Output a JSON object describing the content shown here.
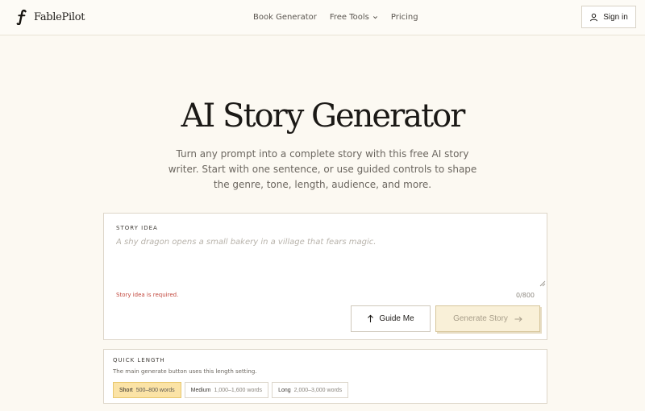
{
  "brand": {
    "name": "FablePilot",
    "logo_icon": "f-letter-logo-icon"
  },
  "nav": {
    "items": [
      {
        "label": "Book Generator"
      },
      {
        "label": "Free Tools",
        "icon": "chevron-down-icon"
      },
      {
        "label": "Pricing"
      }
    ]
  },
  "signin": {
    "label": "Sign in",
    "icon": "user-icon"
  },
  "hero": {
    "title": "AI Story Generator",
    "subtitle": "Turn any prompt into a complete story with this free AI story writer. Start with one sentence, or use guided controls to shape the genre, tone, length, audience, and more."
  },
  "story": {
    "label": "STORY IDEA",
    "value": "",
    "placeholder": "A shy dragon opens a small bakery in a village that fears magic.",
    "error": "Story idea is required.",
    "char_count": "0/800",
    "guide_label": "Guide Me",
    "guide_icon": "arrow-up-icon",
    "generate_label": "Generate Story",
    "generate_icon": "arrow-right-icon"
  },
  "length": {
    "label": "QUICK LENGTH",
    "help": "The main generate button uses this length setting.",
    "selected": "Short",
    "options": [
      {
        "name": "Short",
        "range": "500–800 words"
      },
      {
        "name": "Medium",
        "range": "1,000–1,600 words"
      },
      {
        "name": "Long",
        "range": "2,000–3,000 words"
      }
    ]
  },
  "colors": {
    "page_bg": "#fcf9f2",
    "accent": "#fbe3a6",
    "error": "#c2473d",
    "generate_button_bg": "#f9f0d8"
  }
}
